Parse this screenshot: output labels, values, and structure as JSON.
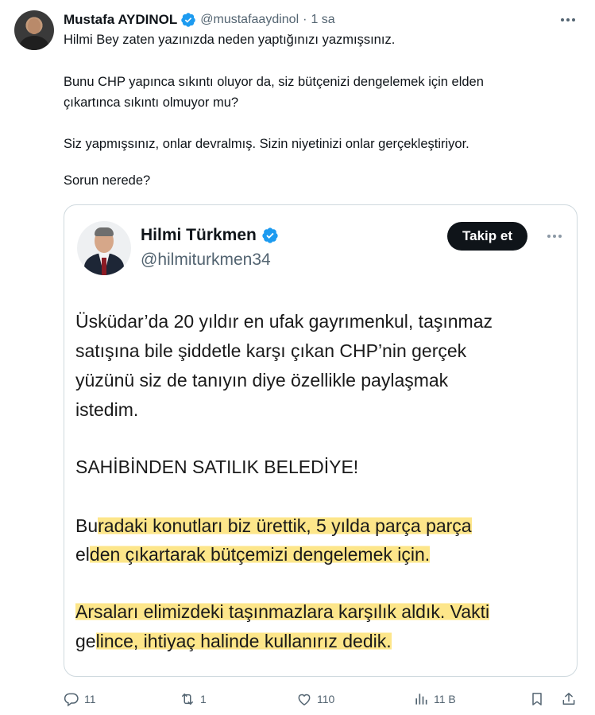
{
  "author": {
    "name": "Mustafa AYDINOL",
    "handle": "@mustafaaydinol",
    "separator": "·",
    "time": "1 sa"
  },
  "tweet": {
    "paragraphs": [
      "Hilmi Bey zaten yazınızda neden yaptığınızı yazmışsınız.",
      "Bunu CHP yapınca sıkıntı oluyor da, siz bütçenizi dengelemek için elden",
      "çıkartınca sıkıntı olmuyor mu?",
      "Siz yapmışsınız, onlar devralmış. Sizin niyetinizi onlar gerçekleştiriyor.",
      "Sorun nerede?"
    ]
  },
  "quoted": {
    "name": "Hilmi Türkmen",
    "handle": "@hilmiturkmen34",
    "follow_label": "Takip et",
    "lines": [
      "Üsküdar’da 20 yıldır en ufak gayrımenkul, taşınmaz",
      "satışına bile şiddetle karşı çıkan CHP’nin gerçek",
      "yüzünü siz de tanıyın diye özellikle paylaşmak",
      "istedim.",
      "SAHİBİNDEN SATILIK BELEDİYE!"
    ],
    "highlight": {
      "l1_pre": "Bu",
      "l1_hl": "radaki konutları biz ürettik, 5 yılda parça parça",
      "l2_pre": "el",
      "l2_hl": "den çıkartarak bütçemizi dengelemek için.",
      "l3_hl": "Arsaları elimizdeki taşınmazlara karşılık aldık. Vakti",
      "l4_pre": "ge",
      "l4_hl": "lince, ihtiyaç halinde kullanırız dedik."
    }
  },
  "actions": {
    "replies": "11",
    "reposts": "1",
    "likes": "110",
    "views": "11 B"
  },
  "colors": {
    "verified": "#1d9bf0",
    "muted": "#536471",
    "highlight": "#fde68a",
    "border": "#cfd9de"
  },
  "icons": [
    "verified-badge-icon",
    "more-icon",
    "reply-icon",
    "repost-icon",
    "like-icon",
    "views-icon",
    "bookmark-icon",
    "share-icon"
  ]
}
